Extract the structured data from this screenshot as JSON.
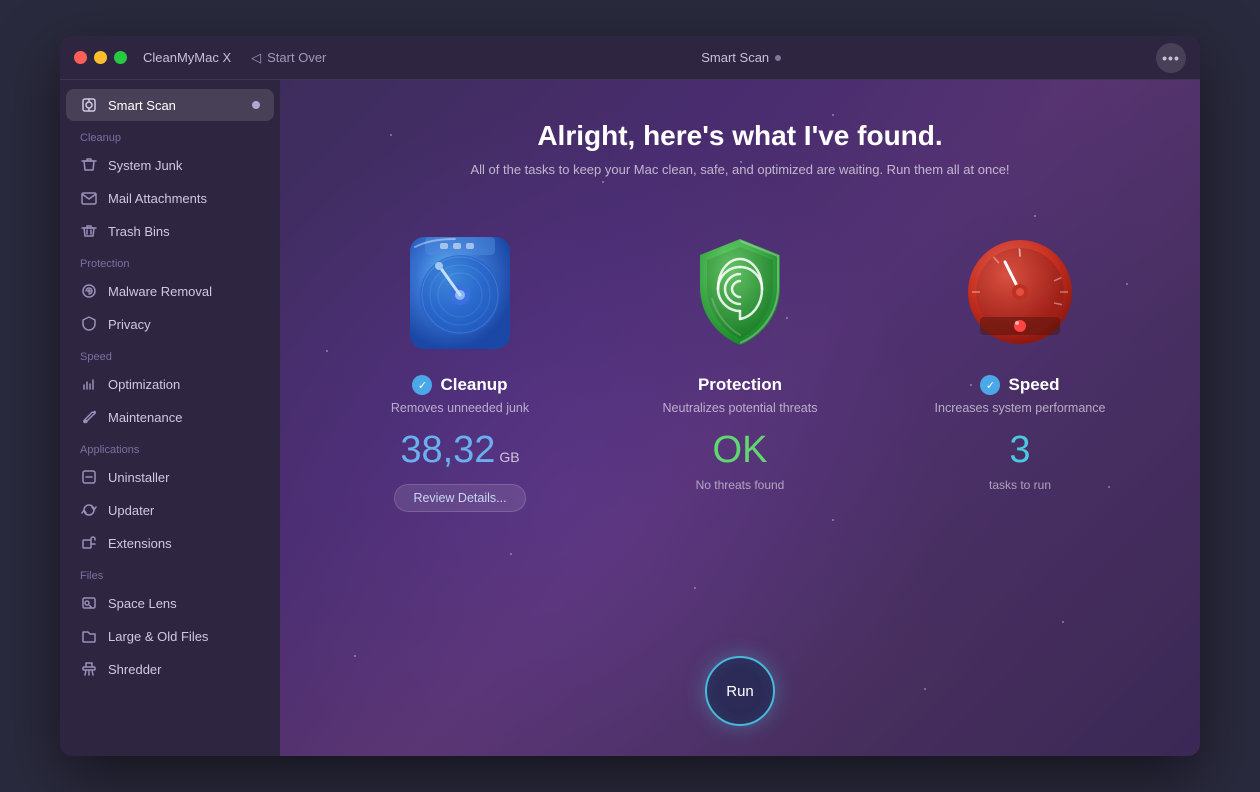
{
  "window": {
    "app_name": "CleanMyMac X",
    "title": "Smart Scan",
    "titlebar_dot": "●",
    "more_icon": "···",
    "nav_back": "Start Over"
  },
  "sidebar": {
    "smart_scan_label": "Smart Scan",
    "sections": [
      {
        "name": "cleanup",
        "label": "Cleanup",
        "items": [
          {
            "id": "system-junk",
            "label": "System Junk"
          },
          {
            "id": "mail-attachments",
            "label": "Mail Attachments"
          },
          {
            "id": "trash-bins",
            "label": "Trash Bins"
          }
        ]
      },
      {
        "name": "protection",
        "label": "Protection",
        "items": [
          {
            "id": "malware-removal",
            "label": "Malware Removal"
          },
          {
            "id": "privacy",
            "label": "Privacy"
          }
        ]
      },
      {
        "name": "speed",
        "label": "Speed",
        "items": [
          {
            "id": "optimization",
            "label": "Optimization"
          },
          {
            "id": "maintenance",
            "label": "Maintenance"
          }
        ]
      },
      {
        "name": "applications",
        "label": "Applications",
        "items": [
          {
            "id": "uninstaller",
            "label": "Uninstaller"
          },
          {
            "id": "updater",
            "label": "Updater"
          },
          {
            "id": "extensions",
            "label": "Extensions"
          }
        ]
      },
      {
        "name": "files",
        "label": "Files",
        "items": [
          {
            "id": "space-lens",
            "label": "Space Lens"
          },
          {
            "id": "large-old-files",
            "label": "Large & Old Files"
          },
          {
            "id": "shredder",
            "label": "Shredder"
          }
        ]
      }
    ]
  },
  "content": {
    "title": "Alright, here's what I've found.",
    "subtitle": "All of the tasks to keep your Mac clean, safe, and optimized are waiting. Run them all at once!",
    "cards": [
      {
        "id": "cleanup",
        "title": "Cleanup",
        "desc": "Removes unneeded junk",
        "has_check": true,
        "value": "38,32",
        "unit": "GB",
        "sub_label": "",
        "has_review": true,
        "review_label": "Review Details..."
      },
      {
        "id": "protection",
        "title": "Protection",
        "desc": "Neutralizes potential threats",
        "has_check": false,
        "value": "OK",
        "unit": "",
        "sub_label": "No threats found",
        "has_review": false
      },
      {
        "id": "speed",
        "title": "Speed",
        "desc": "Increases system performance",
        "has_check": true,
        "value": "3",
        "unit": "",
        "sub_label": "tasks to run",
        "has_review": false
      }
    ],
    "run_button_label": "Run"
  }
}
